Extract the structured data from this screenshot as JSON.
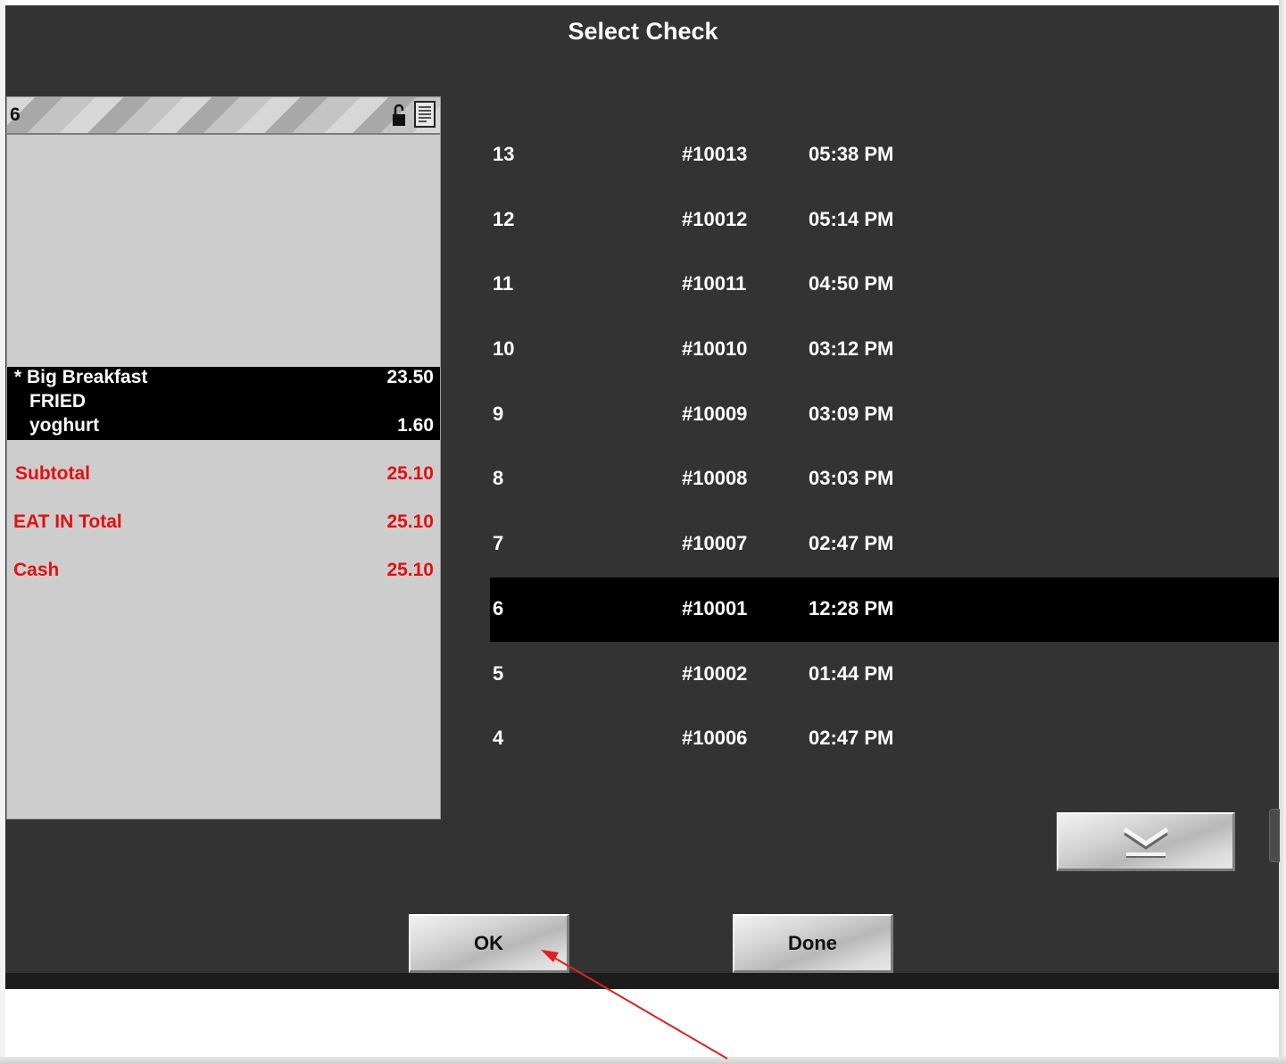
{
  "window": {
    "title": "Select Check"
  },
  "preview": {
    "number": "6",
    "items": [
      {
        "name": "* Big Breakfast",
        "price": "23.50"
      },
      {
        "name": "FRIED",
        "price": ""
      },
      {
        "name": "yoghurt",
        "price": "1.60"
      }
    ],
    "totals": [
      {
        "name": "Subtotal",
        "price": "25.10"
      },
      {
        "name": "EAT IN Total",
        "price": "25.10"
      },
      {
        "name": "Cash",
        "price": "25.10"
      }
    ]
  },
  "checks": [
    {
      "num": "13",
      "id": "#10013",
      "time": "05:38 PM",
      "selected": false
    },
    {
      "num": "12",
      "id": "#10012",
      "time": "05:14 PM",
      "selected": false
    },
    {
      "num": "11",
      "id": "#10011",
      "time": "04:50 PM",
      "selected": false
    },
    {
      "num": "10",
      "id": "#10010",
      "time": "03:12 PM",
      "selected": false
    },
    {
      "num": "9",
      "id": "#10009",
      "time": "03:09 PM",
      "selected": false
    },
    {
      "num": "8",
      "id": "#10008",
      "time": "03:03 PM",
      "selected": false
    },
    {
      "num": "7",
      "id": "#10007",
      "time": "02:47 PM",
      "selected": false
    },
    {
      "num": "6",
      "id": "#10001",
      "time": "12:28 PM",
      "selected": true
    },
    {
      "num": "5",
      "id": "#10002",
      "time": "01:44 PM",
      "selected": false
    },
    {
      "num": "4",
      "id": "#10006",
      "time": "02:47 PM",
      "selected": false
    }
  ],
  "buttons": {
    "ok": "OK",
    "done": "Done"
  },
  "icons": {
    "scroll": "chevron-down-icon",
    "lock": "unlocked-padlock-icon",
    "doc": "receipt-icon"
  },
  "colors": {
    "background": "#333333",
    "totals": "#e21010",
    "selection": "#000000",
    "annotation_arrow": "#e02020"
  }
}
